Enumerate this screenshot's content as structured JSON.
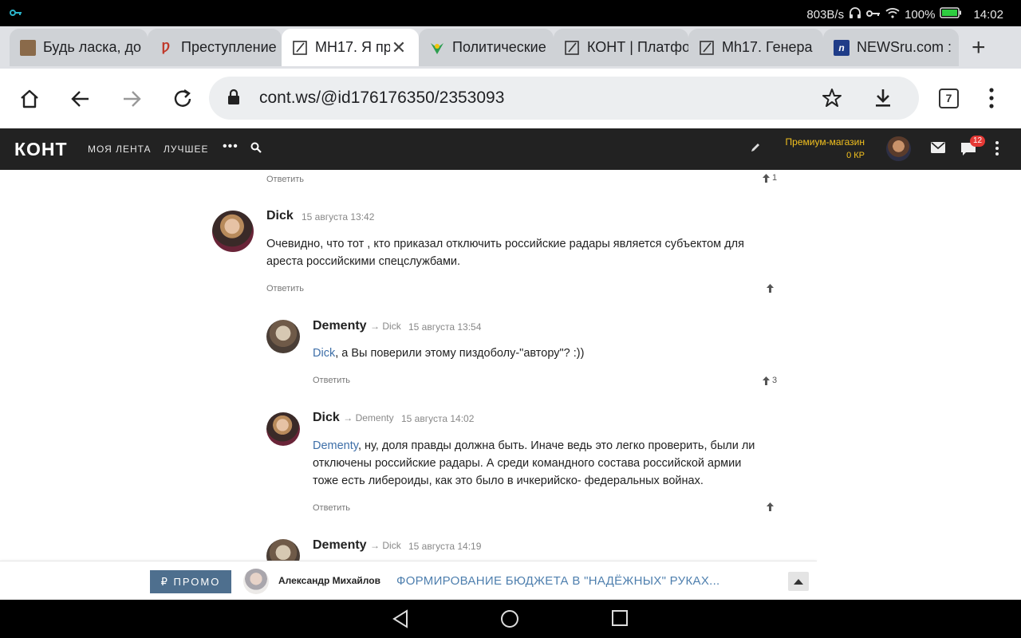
{
  "status_bar": {
    "speed": "803B/s",
    "battery": "100%",
    "time": "14:02"
  },
  "tabs": [
    {
      "title": "Будь ласка, до",
      "favicon": "brown-image-icon",
      "active": false
    },
    {
      "title": "Преступление",
      "favicon": "red-logo-icon",
      "active": false
    },
    {
      "title": "МН17. Я пр",
      "favicon": "pencil-box-icon",
      "active": true
    },
    {
      "title": "Политические",
      "favicon": "colorful-logo-icon",
      "active": false
    },
    {
      "title": "КОНТ | Платфо",
      "favicon": "pencil-box-icon",
      "active": false
    },
    {
      "title": "Мh17. Генера",
      "favicon": "pencil-box-icon",
      "active": false
    },
    {
      "title": "NEWSru.com :",
      "favicon": "newsru-icon",
      "active": false
    }
  ],
  "toolbar": {
    "url": "cont.ws/@id176176350/2353093",
    "tab_count": "7"
  },
  "site_nav": {
    "logo": "КОНТ",
    "links": [
      "МОЯ ЛЕНТА",
      "ЛУЧШЕЕ"
    ],
    "more": "•••",
    "premium_label": "Премиум-магазин",
    "premium_balance": "0 КР",
    "chat_badge": "12"
  },
  "reply_label": "Ответить",
  "top_reply": {
    "votes": "1"
  },
  "comments": [
    {
      "author": "Dick",
      "reply_to": "",
      "date": "15 августа 13:42",
      "mention": "",
      "text_lines": [
        "Очевидно, что тот , кто приказал отключить российские радары является субъектом для",
        "ареста российскими спецслужбами."
      ],
      "votes": ""
    },
    {
      "author": "Dementy",
      "reply_to": "→ Dick",
      "date": "15 августа 13:54",
      "mention": "Dick",
      "text_lines": [
        ", а Вы поверили этому пиздоболу-\"автору\"? :))"
      ],
      "votes": "3"
    },
    {
      "author": "Dick",
      "reply_to": "→ Dementy",
      "date": "15 августа 14:02",
      "mention": "Dementy",
      "text_lines": [
        ", ну, доля правды должна быть. Иначе ведь это легко проверить, были ли",
        "отключены российские радары. А среди командного состава российской армии",
        "тоже есть либероиды, как это было в ичкерийско- федеральных войнах."
      ],
      "votes": ""
    },
    {
      "author": "Dementy",
      "reply_to": "→ Dick",
      "date": "15 августа 14:19"
    }
  ],
  "promo": {
    "badge": "₽ ПРОМО",
    "author": "Александр Михайлов",
    "title": "ФОРМИРОВАНИЕ БЮДЖЕТА В \"НАДЁЖНЫХ\" РУКАХ..."
  }
}
